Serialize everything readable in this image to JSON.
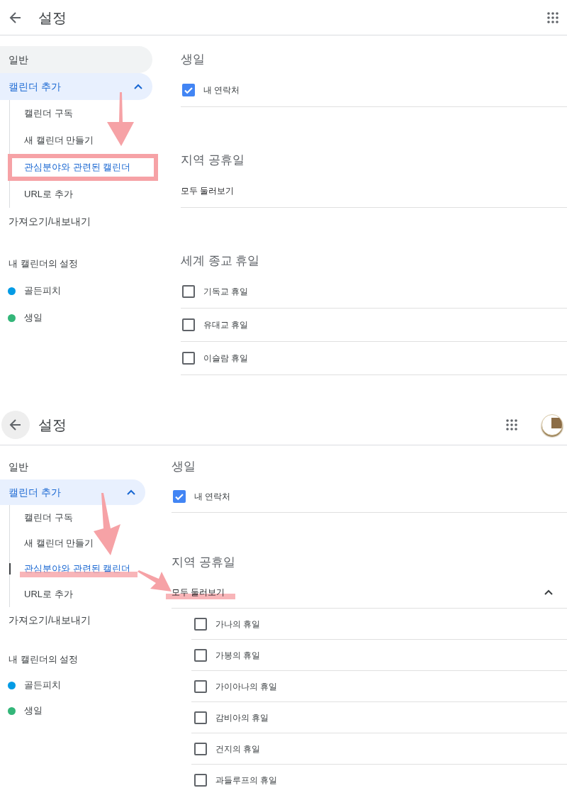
{
  "panels": [
    {
      "header": {
        "title": "설정",
        "back_button": {
          "kind": "plain"
        },
        "avatar": false
      },
      "sidebar": [
        {
          "kind": "item",
          "label": "일반",
          "hovered": true,
          "selected": false
        },
        {
          "kind": "group",
          "label": "캘린더 추가",
          "selected": true,
          "expanded": true,
          "children": [
            {
              "label": "캘린더 구독",
              "selected": false
            },
            {
              "label": "새 캘린더 만들기",
              "selected": false
            },
            {
              "label": "관심분야와 관련된 캘린더",
              "selected": true,
              "annotation": {
                "kind": "box"
              }
            },
            {
              "label": "URL로 추가",
              "selected": false
            }
          ]
        },
        {
          "kind": "item",
          "label": "가져오기/내보내기",
          "hovered": false,
          "selected": false
        },
        {
          "kind": "heading",
          "label": "내 캘린더의 설정"
        },
        {
          "kind": "calendar",
          "label": "골든피치",
          "color": "#039be5"
        },
        {
          "kind": "calendar",
          "label": "생일",
          "color": "#33b679"
        }
      ],
      "sections": [
        {
          "title": "생일",
          "rows": [
            {
              "kind": "checkbox",
              "label": "내 연락처",
              "checked": true
            }
          ]
        },
        {
          "title": "지역 공휴일",
          "rows": [
            {
              "kind": "expander",
              "label": "모두 둘러보기",
              "expanded": false
            }
          ]
        },
        {
          "title": "세계 종교 휴일",
          "rows": [
            {
              "kind": "checkbox",
              "label": "기독교 휴일",
              "checked": false
            },
            {
              "kind": "checkbox",
              "label": "유대교 휴일",
              "checked": false
            },
            {
              "kind": "checkbox",
              "label": "이슬람 휴일",
              "checked": false
            }
          ]
        }
      ],
      "arrows": [
        {
          "kind": "down"
        }
      ]
    },
    {
      "header": {
        "title": "설정",
        "back_button": {
          "kind": "circle"
        },
        "avatar": true
      },
      "sidebar": [
        {
          "kind": "item",
          "label": "일반",
          "hovered": false,
          "selected": false
        },
        {
          "kind": "group",
          "label": "캘린더 추가",
          "selected": true,
          "expanded": true,
          "children": [
            {
              "label": "캘린더 구독",
              "selected": false
            },
            {
              "label": "새 캘린더 만들기",
              "selected": false
            },
            {
              "label": "관심분야와 관련된 캘린더",
              "selected": true,
              "annotation": {
                "kind": "underline"
              }
            },
            {
              "label": "URL로 추가",
              "selected": false
            }
          ]
        },
        {
          "kind": "item",
          "label": "가져오기/내보내기",
          "hovered": false,
          "selected": false
        },
        {
          "kind": "heading",
          "label": "내 캘린더의 설정"
        },
        {
          "kind": "calendar",
          "label": "골든피치",
          "color": "#039be5"
        },
        {
          "kind": "calendar",
          "label": "생일",
          "color": "#33b679"
        }
      ],
      "sections": [
        {
          "title": "생일",
          "rows": [
            {
              "kind": "checkbox",
              "label": "내 연락처",
              "checked": true
            }
          ]
        },
        {
          "title": "지역 공휴일",
          "rows": [
            {
              "kind": "expander",
              "label": "모두 둘러보기",
              "expanded": true,
              "annotation": {
                "kind": "underline"
              },
              "children": [
                {
                  "label": "가나의 휴일",
                  "checked": false
                },
                {
                  "label": "가봉의 휴일",
                  "checked": false
                },
                {
                  "label": "가이아나의 휴일",
                  "checked": false
                },
                {
                  "label": "감비아의 휴일",
                  "checked": false
                },
                {
                  "label": "건지의 휴일",
                  "checked": false
                },
                {
                  "label": "과들루프의 휴일",
                  "checked": false
                }
              ]
            }
          ]
        }
      ],
      "arrows": [
        {
          "kind": "down"
        },
        {
          "kind": "right"
        }
      ]
    }
  ]
}
